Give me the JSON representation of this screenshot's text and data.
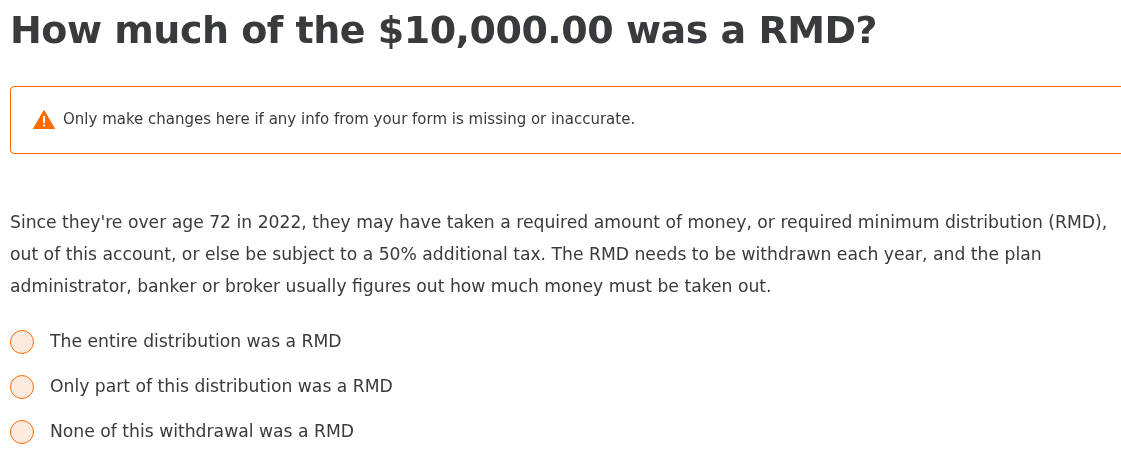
{
  "heading": "How much of the $10,000.00 was a RMD?",
  "alert": {
    "text": "Only make changes here if any info from your form is missing or inaccurate."
  },
  "description": "Since they're over age 72 in 2022, they may have taken a required amount of money, or required minimum distribution (RMD), out of this account, or else be subject to a 50% additional tax. The RMD needs to be withdrawn each year, and the plan administrator, banker or broker usually figures out how much money must be taken out.",
  "options": [
    {
      "label": "The entire distribution was a RMD",
      "selected": false
    },
    {
      "label": "Only part of this distribution was a RMD",
      "selected": false
    },
    {
      "label": "None of this withdrawal was a RMD",
      "selected": false
    }
  ]
}
